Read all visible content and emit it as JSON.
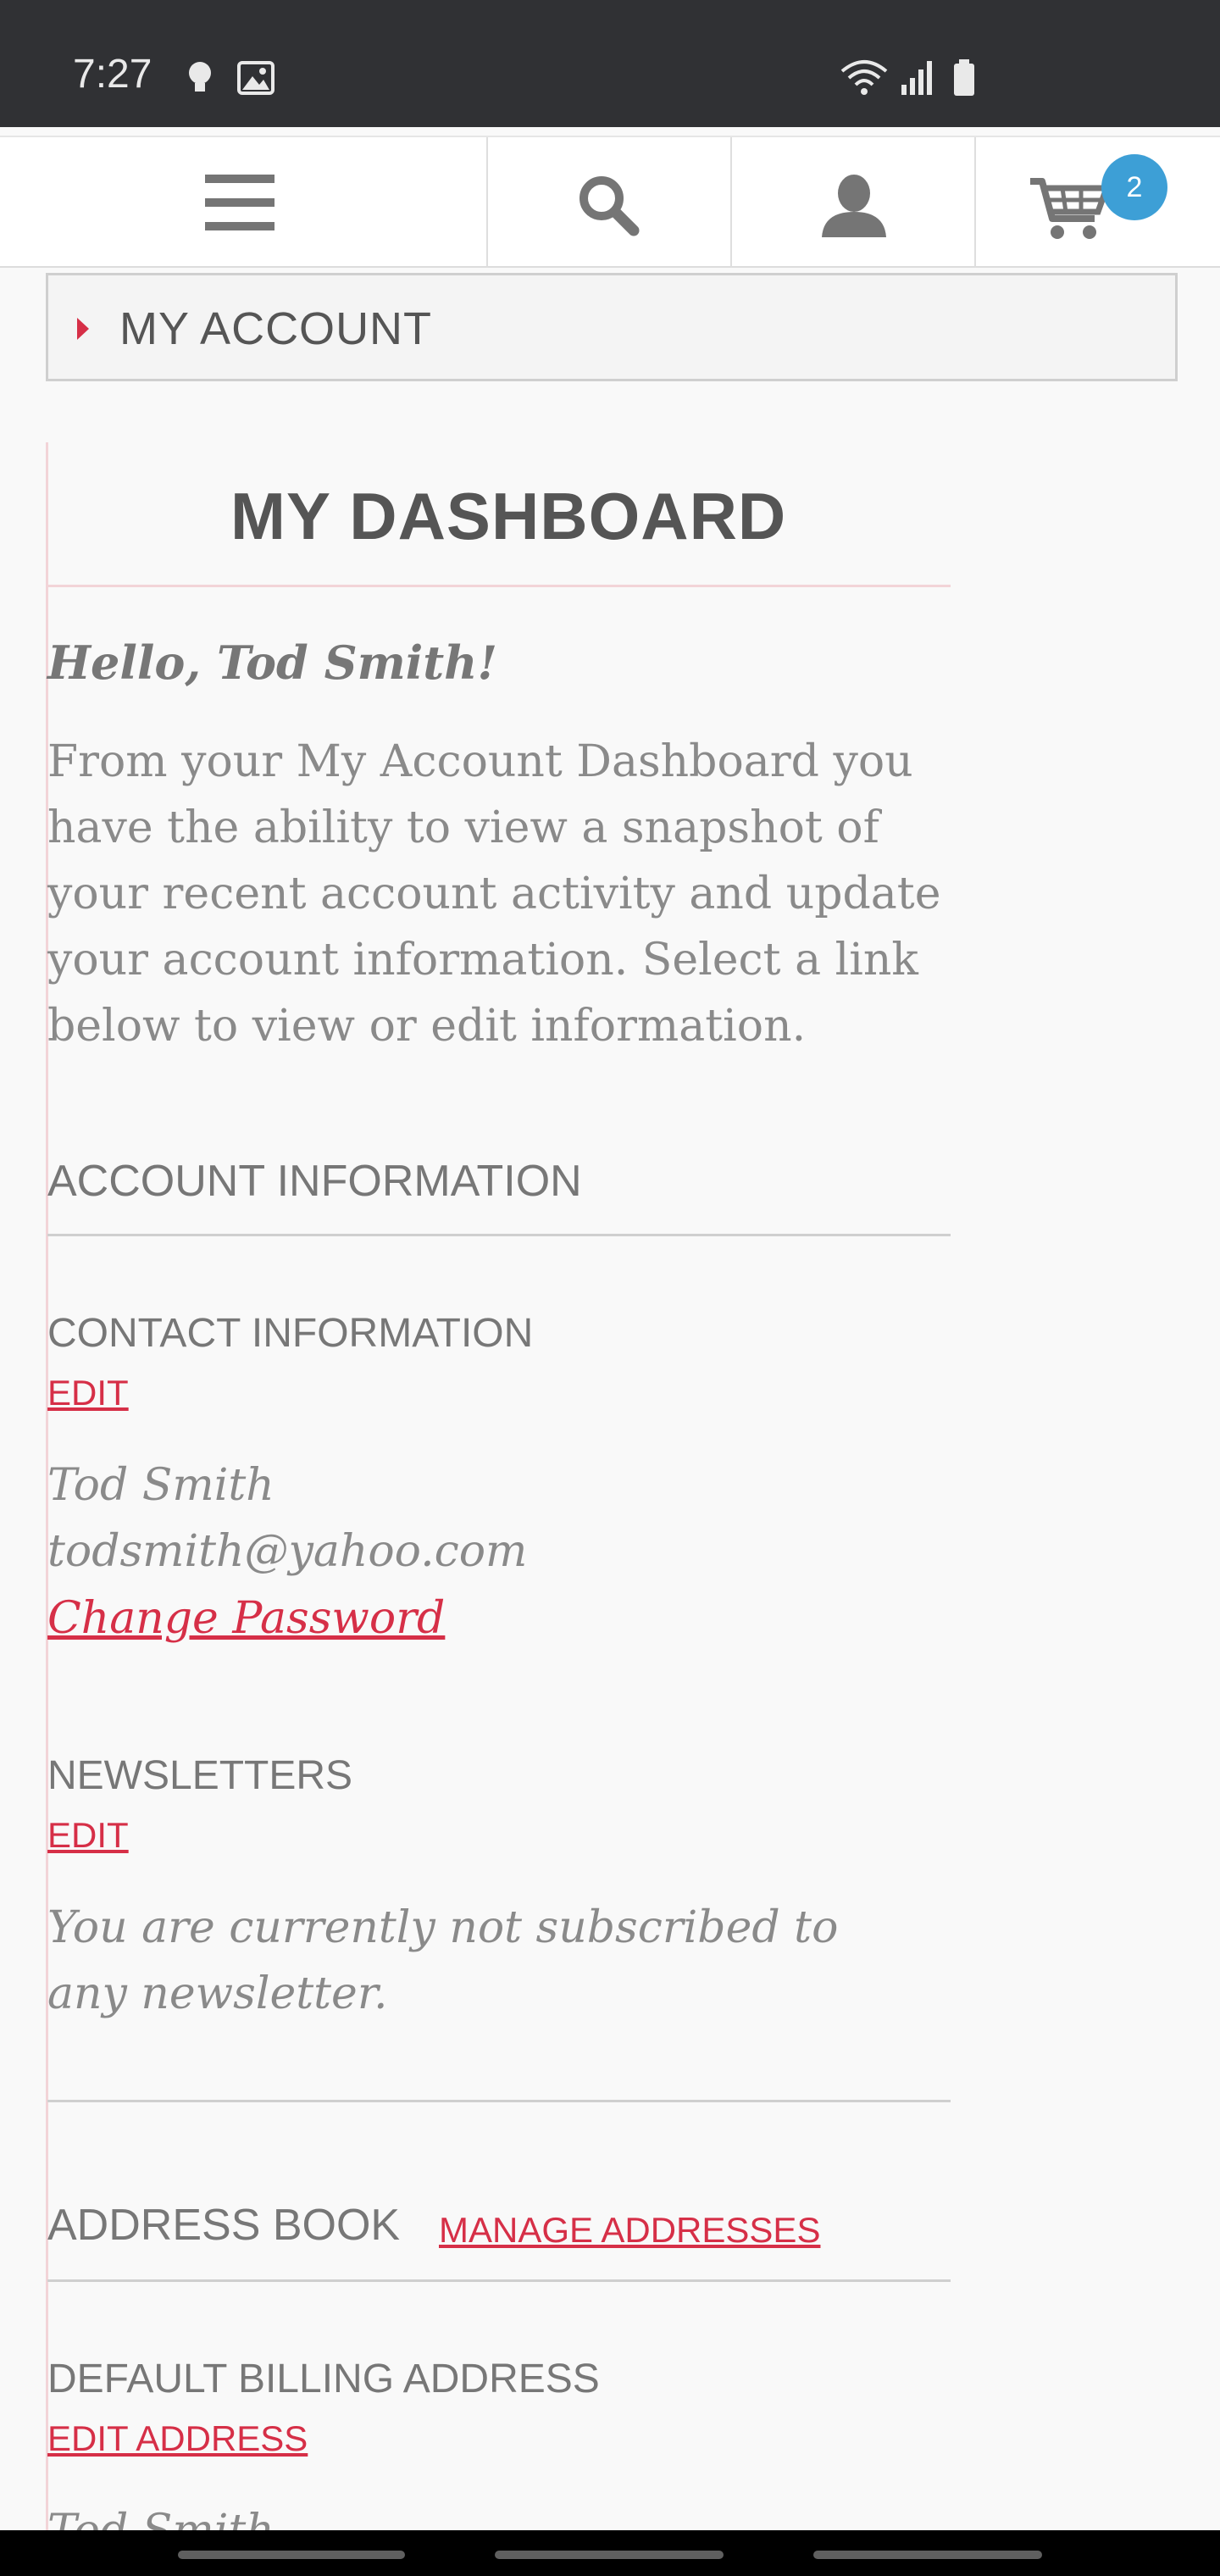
{
  "status_bar": {
    "time": "7:27",
    "icons": [
      "bulb-icon",
      "image-icon",
      "wifi-icon",
      "signal-icon",
      "battery-icon"
    ]
  },
  "nav": {
    "menu_icon": "hamburger-icon",
    "search_icon": "search-icon",
    "account_icon": "user-icon",
    "cart_icon": "cart-icon",
    "cart_count": "2"
  },
  "account_bar": {
    "label": "MY ACCOUNT"
  },
  "dashboard": {
    "title": "MY DASHBOARD",
    "greeting": "Hello, Tod Smith!",
    "intro": "From your My Account Dashboard you have the ability to view a snapshot of your recent account activity and update your account information. Select a link below to view or edit information."
  },
  "account_info": {
    "heading": "ACCOUNT INFORMATION",
    "contact": {
      "heading": "CONTACT INFORMATION",
      "edit_label": "EDIT",
      "name": "Tod Smith",
      "email": "todsmith@yahoo.com",
      "change_password": "Change Password"
    },
    "newsletters": {
      "heading": "NEWSLETTERS",
      "edit_label": "EDIT",
      "status": "You are currently not subscribed to any newsletter."
    }
  },
  "address_book": {
    "heading": "ADDRESS BOOK",
    "manage_label": "MANAGE ADDRESSES",
    "billing": {
      "heading": "DEFAULT BILLING ADDRESS",
      "edit_label": "EDIT ADDRESS",
      "name_partial": "Tod Smith"
    }
  },
  "colors": {
    "accent": "#d62f47",
    "badge": "#3d9fd6",
    "status_bar": "#303134"
  }
}
